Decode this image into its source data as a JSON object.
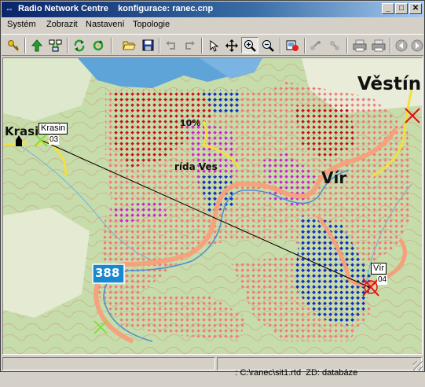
{
  "window": {
    "title": "Radio Network Centre    konfigurace: ranec.cnp",
    "minimize": "_",
    "maximize": "□",
    "close": "✕"
  },
  "menu": [
    {
      "id": "system",
      "label": "Systém"
    },
    {
      "id": "zobrazit",
      "label": "Zobrazit"
    },
    {
      "id": "nastaveni",
      "label": "Nastavení"
    },
    {
      "id": "topologie",
      "label": "Topologie"
    }
  ],
  "toolbar": {
    "icons": [
      "key-icon",
      "arrow-up-icon",
      "network-icon",
      "refresh-icon",
      "refresh-alt-icon",
      "open-folder-icon",
      "save-icon",
      "undo-icon",
      "redo-icon",
      "pointer-icon",
      "move-icon",
      "zoom-in-icon",
      "zoom-out-icon",
      "map-export-icon",
      "link-icon",
      "link-alt-icon",
      "printer-icon",
      "printer-alt-icon",
      "back-icon",
      "forward-icon"
    ]
  },
  "map": {
    "labels": {
      "town_top_right": "Věstín",
      "town_left": "Krasin",
      "town_left_partial": "Krasi",
      "village_mid": "rída Ves",
      "village_right": "Vír",
      "station_left_name": "Krasin",
      "station_left_id": "03",
      "station_right_name": "Vír",
      "station_right_id": "04",
      "road_number": "388",
      "percent_label": "10%"
    },
    "colors": {
      "water": "#5fa4d9",
      "forest": "#b9d39a",
      "road_main": "#f5a07a",
      "coverage_strong": "#c8101a",
      "coverage_weak": "#f27a7a",
      "coverage_magenta": "#d020d0",
      "coverage_blue": "#1030c0",
      "station_marker": "#e01010",
      "reference_marker": "#80e040"
    }
  },
  "status": {
    "panel_left": "",
    "file": ": C:\\ranec\\sit1.rtd",
    "zd": "ZD: databáze"
  }
}
